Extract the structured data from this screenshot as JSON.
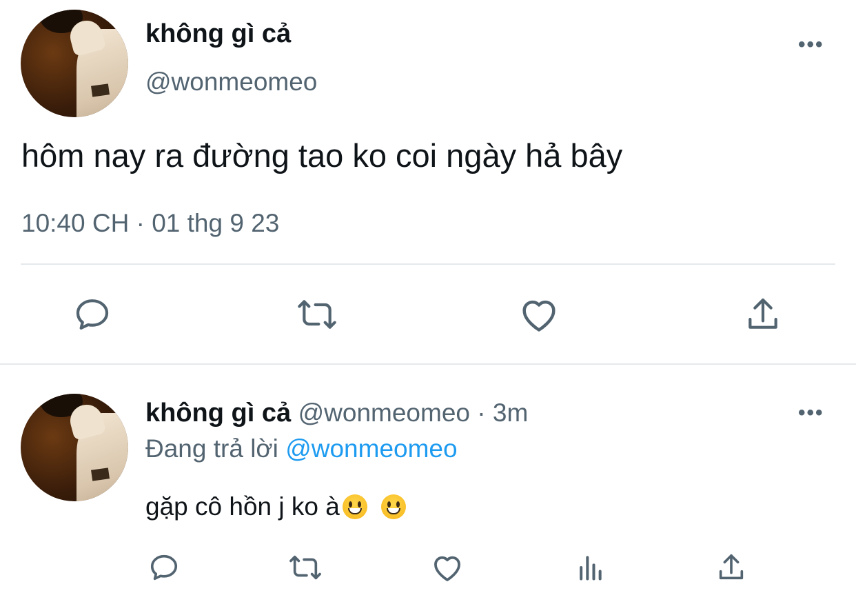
{
  "main_tweet": {
    "display_name": "không gì cả",
    "handle": "@wonmeomeo",
    "more_label": "•••",
    "text": "hôm nay ra đường tao ko coi ngày hả bây",
    "timestamp": "10:40 CH · 01 thg 9 23",
    "actions": [
      "reply-icon",
      "retweet-icon",
      "like-icon",
      "share-icon"
    ]
  },
  "reply_tweet": {
    "display_name": "không gì cả",
    "handle_time": "@wonmeomeo · 3m",
    "more_label": "•••",
    "replying_prefix": "Đang trả lời ",
    "replying_to": "@wonmeomeo",
    "text": "gặp cô hồn j ko à",
    "emojis": [
      "grinning-face",
      "grinning-face"
    ],
    "actions": [
      "reply-icon",
      "retweet-icon",
      "like-icon",
      "analytics-icon",
      "share-icon"
    ]
  },
  "colors": {
    "text": "#0f1419",
    "secondary": "#536471",
    "link": "#1d9bf0",
    "divider": "#e6e9ec"
  }
}
